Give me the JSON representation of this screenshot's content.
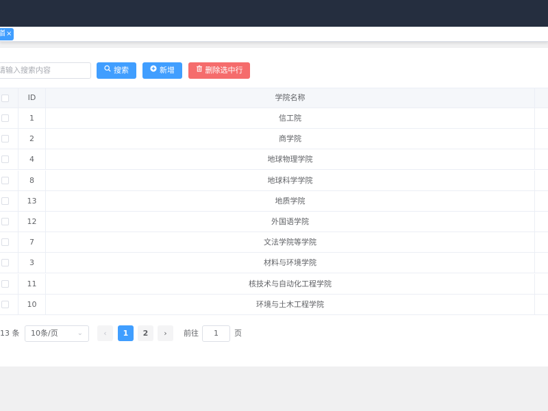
{
  "tags": [
    {
      "label": "首页",
      "close": "×"
    }
  ],
  "toolbar": {
    "search_placeholder": "请输入搜索内容",
    "search_label": "搜索",
    "add_label": "新增",
    "delete_label": "删除选中行"
  },
  "table": {
    "columns": {
      "id": "ID",
      "name": "学院名称"
    },
    "rows": [
      {
        "id": "1",
        "name": "信工院"
      },
      {
        "id": "2",
        "name": "商学院"
      },
      {
        "id": "4",
        "name": "地球物理学院"
      },
      {
        "id": "8",
        "name": "地球科学学院"
      },
      {
        "id": "13",
        "name": "地质学院"
      },
      {
        "id": "12",
        "name": "外国语学院"
      },
      {
        "id": "7",
        "name": "文法学院等学院"
      },
      {
        "id": "3",
        "name": "材料与环境学院"
      },
      {
        "id": "11",
        "name": "核技术与自动化工程学院"
      },
      {
        "id": "10",
        "name": "环境与土木工程学院"
      }
    ]
  },
  "pagination": {
    "total_text": "13 条",
    "page_size": "10条/页",
    "pages": [
      "1",
      "2"
    ],
    "current": "1",
    "goto_label": "前往",
    "goto_value": "1",
    "goto_suffix": "页"
  },
  "colors": {
    "header": "#252e3f",
    "primary": "#409eff",
    "danger": "#f56c6c"
  }
}
